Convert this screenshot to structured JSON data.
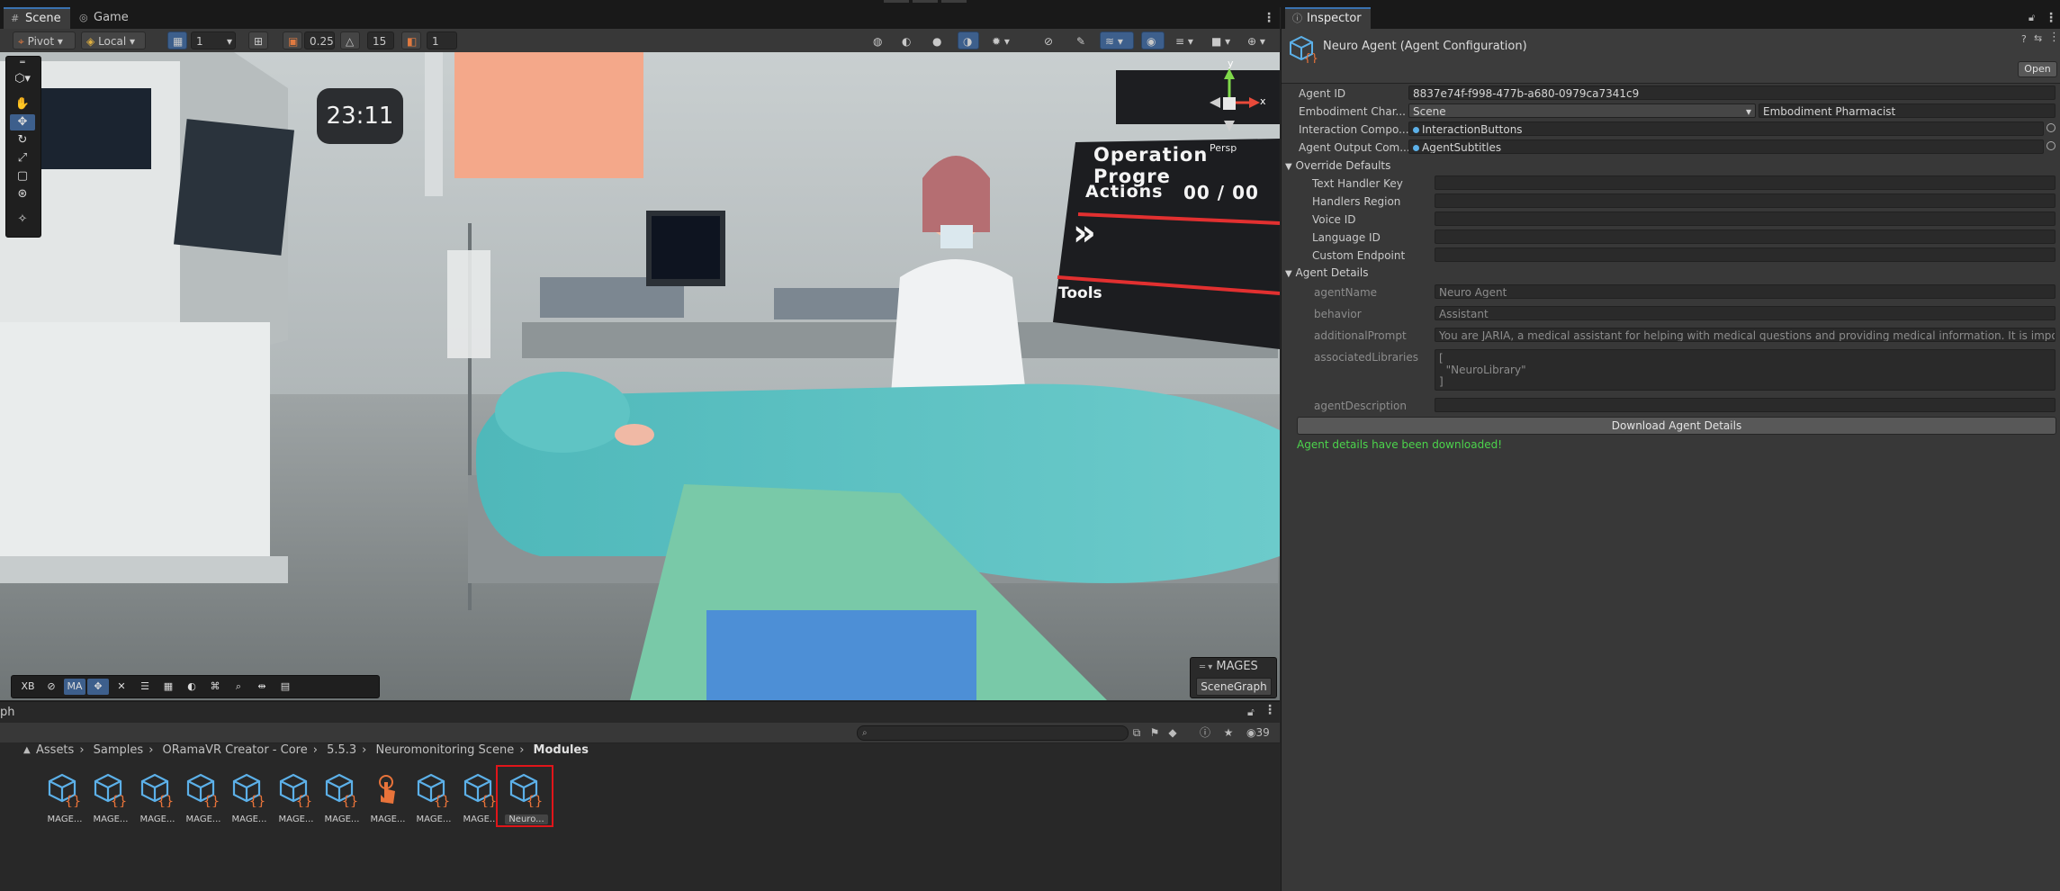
{
  "scene_panel": {
    "tabs": [
      {
        "label": "Scene",
        "icon": "hash-grid-icon"
      },
      {
        "label": "Game",
        "icon": "gamepad-icon"
      }
    ],
    "toolbar": {
      "pivot_label": "Pivot",
      "space_label": "Local",
      "grid_value": "1",
      "snap_increment": "0.25",
      "rotate_snap": "15",
      "scale_snap": "1"
    },
    "viewport_overlay": {
      "clock_text": "23:11",
      "board_title": "Operation Progre",
      "board_actions_label": "Actions",
      "board_actions_count": "00 / 00",
      "board_tools_label": "Tools",
      "board_chevron": "»",
      "persp_label": "Persp",
      "gizmo_x": "x",
      "gizmo_y": "y",
      "bottom_tools": [
        "XB",
        "",
        "MA"
      ],
      "mages_title": "MAGES",
      "scenegraph_label": "SceneGraph"
    }
  },
  "project_panel": {
    "tab_label": "ph",
    "result_count": "39",
    "breadcrumb": [
      "Assets",
      "Samples",
      "ORamaVR Creator - Core",
      "5.5.3",
      "Neuromonitoring Scene",
      "Modules"
    ],
    "assets": [
      {
        "label": "MAGE...",
        "kind": "script-cube"
      },
      {
        "label": "MAGE...",
        "kind": "script-cube"
      },
      {
        "label": "MAGE...",
        "kind": "script-cube"
      },
      {
        "label": "MAGE...",
        "kind": "script-cube"
      },
      {
        "label": "MAGE...",
        "kind": "script-cube"
      },
      {
        "label": "MAGE...",
        "kind": "script-cube"
      },
      {
        "label": "MAGE...",
        "kind": "script-cube"
      },
      {
        "label": "MAGE...",
        "kind": "interaction-hand"
      },
      {
        "label": "MAGE...",
        "kind": "script-cube"
      },
      {
        "label": "MAGE...",
        "kind": "script-cube"
      },
      {
        "label": "Neuro...",
        "kind": "script-cube",
        "selected": true
      }
    ]
  },
  "inspector": {
    "tab_label": "Inspector",
    "component_title": "Neuro Agent (Agent Configuration)",
    "open_label": "Open",
    "fields": {
      "agent_id_label": "Agent ID",
      "agent_id_value": "8837e74f-f998-477b-a680-0979ca7341c9",
      "embodiment_label": "Embodiment Char...",
      "embodiment_dropdown": "Scene",
      "embodiment_value": "Embodiment Pharmacist",
      "interaction_label": "Interaction Compo...",
      "interaction_value": "InteractionButtons",
      "output_label": "Agent Output Com...",
      "output_value": "AgentSubtitles"
    },
    "override": {
      "header": "Override Defaults",
      "text_handler_key": "Text Handler Key",
      "handlers_region": "Handlers Region",
      "voice_id": "Voice ID",
      "language_id": "Language ID",
      "custom_endpoint": "Custom Endpoint"
    },
    "details": {
      "header": "Agent Details",
      "agent_name_label": "agentName",
      "agent_name_value": "Neuro Agent",
      "behavior_label": "behavior",
      "behavior_value": "Assistant",
      "additional_prompt_label": "additionalPrompt",
      "additional_prompt_value": "You are JARIA, a medical assistant for helping with medical questions and providing medical information. It is important t",
      "libraries_label": "associatedLibraries",
      "libraries_lines": [
        "[",
        "  \"NeuroLibrary\"",
        "]"
      ],
      "description_label": "agentDescription",
      "description_value": ""
    },
    "download_label": "Download Agent Details",
    "status_text": "Agent details have been downloaded!",
    "status_color": "#4cd44c"
  },
  "colors": {
    "accent": "#3d5f8c",
    "selection_outline": "#e0151a",
    "script_icon_blue": "#5cb0e8",
    "script_icon_orange": "#e8733a"
  }
}
